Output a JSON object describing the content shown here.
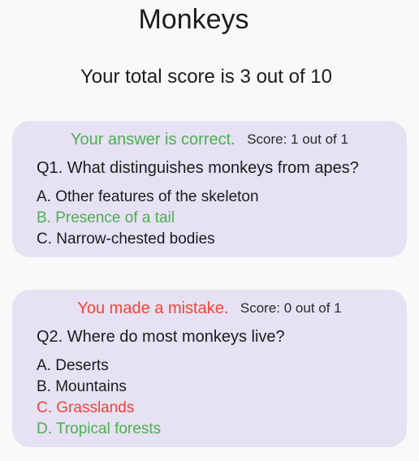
{
  "title": "Monkeys",
  "total_score": "Your total score is 3 out of 10",
  "colors": {
    "background": "#f9f9f9",
    "card": "#e6e1f3",
    "correct": "#4caf50",
    "wrong": "#f44336"
  },
  "questions": [
    {
      "verdict": "Your answer is correct.",
      "score": "Score: 1 out of 1",
      "question": "Q1. What distinguishes monkeys from apes?",
      "options": [
        {
          "text": "A. Other features of the skeleton",
          "status": "neutral"
        },
        {
          "text": "B. Presence of a tail",
          "status": "correct"
        },
        {
          "text": "C. Narrow-chested bodies",
          "status": "neutral"
        }
      ]
    },
    {
      "verdict": "You made a mistake.",
      "score": "Score: 0 out of 1",
      "question": "Q2. Where do most monkeys live?",
      "options": [
        {
          "text": "A. Deserts",
          "status": "neutral"
        },
        {
          "text": "B. Mountains",
          "status": "neutral"
        },
        {
          "text": "C. Grasslands",
          "status": "wrong"
        },
        {
          "text": "D. Tropical forests",
          "status": "correct"
        }
      ]
    }
  ]
}
